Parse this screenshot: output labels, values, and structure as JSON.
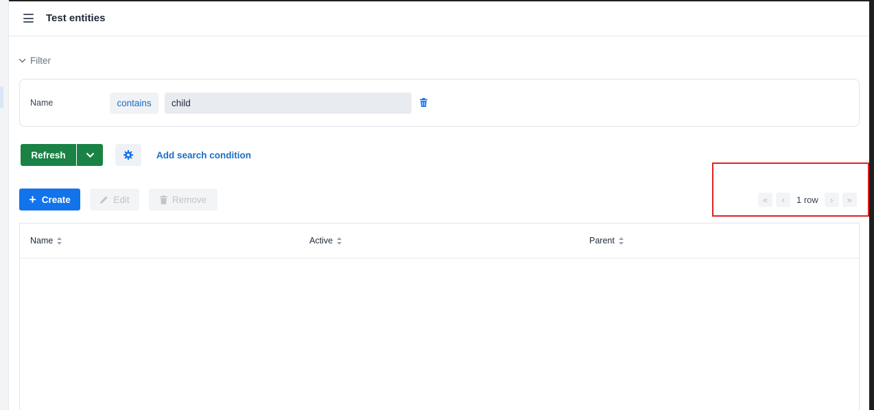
{
  "header": {
    "title": "Test entities"
  },
  "filter": {
    "toggle_label": "Filter",
    "condition": {
      "name": "Name",
      "operator": "contains",
      "value": "child"
    },
    "refresh_label": "Refresh",
    "add_condition_label": "Add search condition"
  },
  "toolbar": {
    "create_label": "Create",
    "edit_label": "Edit",
    "remove_label": "Remove"
  },
  "pagination": {
    "row_count_label": "1 row"
  },
  "table": {
    "columns": [
      "Name",
      "Active",
      "Parent"
    ]
  },
  "colors": {
    "accent": "#1273eb",
    "refresh": "#1a8245",
    "link": "#1b6ec2",
    "highlight": "#e02020"
  }
}
